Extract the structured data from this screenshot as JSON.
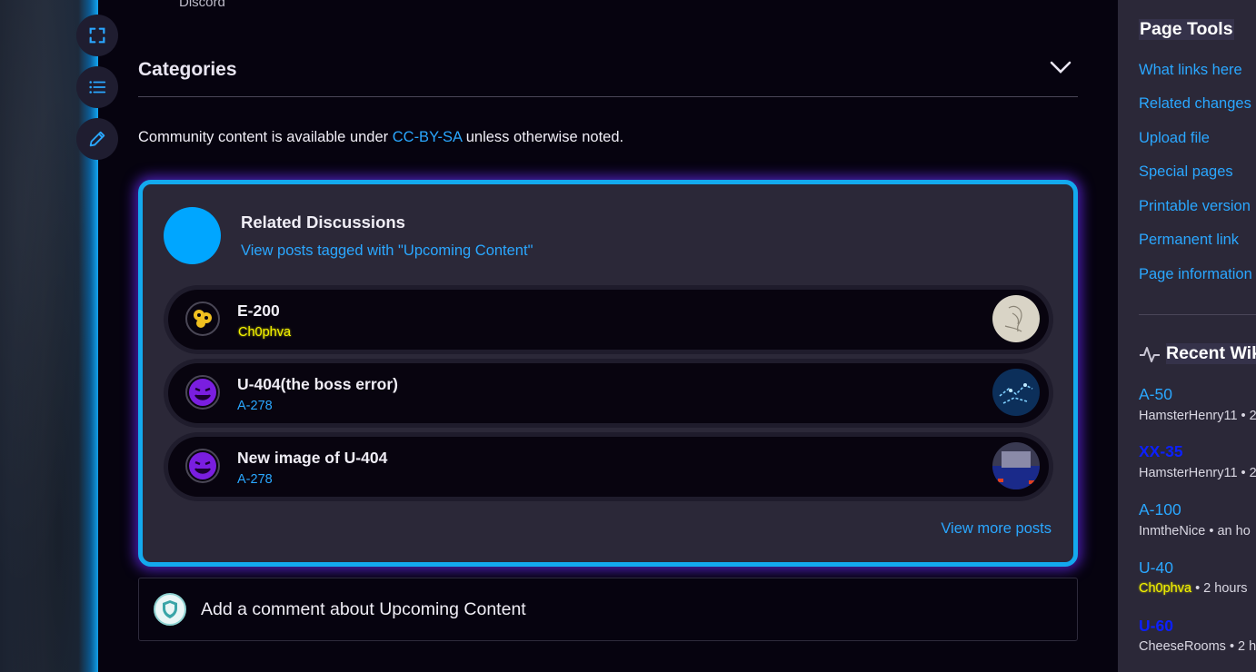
{
  "top_partial": {
    "discord_label": "Discord"
  },
  "rail": {
    "buttons": [
      "fullscreen-icon",
      "list-icon",
      "edit-icon"
    ]
  },
  "categories": {
    "title": "Categories"
  },
  "license": {
    "prefix": "Community content is available under ",
    "link": "CC-BY-SA",
    "suffix": " unless otherwise noted."
  },
  "related": {
    "title": "Related Discussions",
    "subtitle": "View posts tagged with \"Upcoming Content\"",
    "posts": [
      {
        "title": "E-200",
        "author": "Ch0phva",
        "author_highlight": true
      },
      {
        "title": "U-404(the boss error)",
        "author": "A-278",
        "author_highlight": false
      },
      {
        "title": "New image of U-404",
        "author": "A-278",
        "author_highlight": false
      }
    ],
    "view_more": "View more posts"
  },
  "comment": {
    "placeholder": "Add a comment about Upcoming Content"
  },
  "sidebar": {
    "page_tools_title": "Page Tools",
    "tools": [
      "What links here",
      "Related changes",
      "Upload file",
      "Special pages",
      "Printable version",
      "Permanent link",
      "Page information"
    ],
    "recent_title": "Recent Wiki Activity",
    "recent": [
      {
        "title": "A-50",
        "user": "HamsterHenry11",
        "time": " • 2",
        "dark": false,
        "user_highlight": false
      },
      {
        "title": "XX-35",
        "user": "HamsterHenry11",
        "time": " • 2",
        "dark": true,
        "user_highlight": false
      },
      {
        "title": "A-100",
        "user": "InmtheNice",
        "time": " • an ho",
        "dark": false,
        "user_highlight": false
      },
      {
        "title": "U-40",
        "user": "Ch0phva",
        "time": " • 2 hours",
        "dark": false,
        "user_highlight": true
      },
      {
        "title": "U-60",
        "user": "CheeseRooms",
        "time": " • 2 h",
        "dark": true,
        "user_highlight": false
      }
    ]
  },
  "colors": {
    "accent": "#2aa7ff",
    "border_glow": "#13a9ee",
    "highlight_yellow": "#f2f200"
  }
}
